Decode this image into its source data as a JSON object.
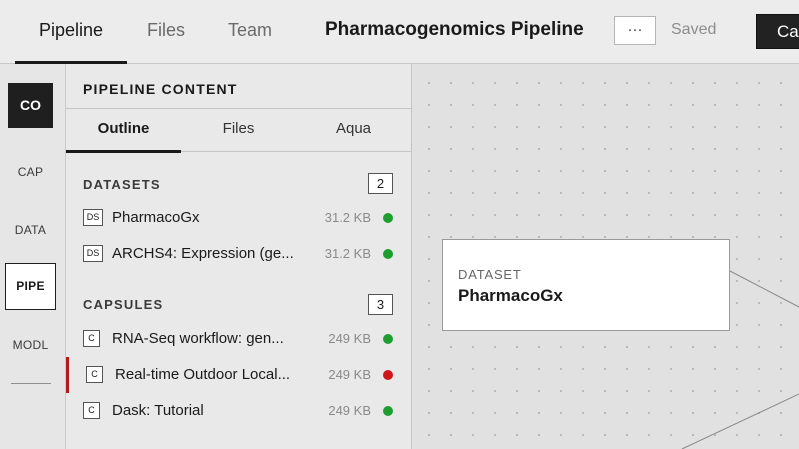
{
  "header": {
    "tabs": [
      {
        "label": "Pipeline",
        "active": true
      },
      {
        "label": "Files",
        "active": false
      },
      {
        "label": "Team",
        "active": false
      }
    ],
    "title": "Pharmacogenomics Pipeline",
    "more_label": "···",
    "status": "Saved",
    "cta_label": "Ca"
  },
  "rail": {
    "avatar": "CO",
    "items": [
      {
        "label": "CAP"
      },
      {
        "label": "DATA"
      },
      {
        "label": "PIPE",
        "active": true
      },
      {
        "label": "MODL"
      }
    ]
  },
  "panel": {
    "title": "PIPELINE CONTENT",
    "tabs": [
      {
        "label": "Outline",
        "active": true
      },
      {
        "label": "Files",
        "active": false
      },
      {
        "label": "Aqua",
        "active": false
      }
    ],
    "datasets": {
      "heading": "DATASETS",
      "count": "2",
      "items": [
        {
          "badge": "DS",
          "name": "PharmacoGx",
          "size": "31.2 KB",
          "status": "green"
        },
        {
          "badge": "DS",
          "name": "ARCHS4: Expression (ge...",
          "size": "31.2 KB",
          "status": "green"
        }
      ]
    },
    "capsules": {
      "heading": "CAPSULES",
      "count": "3",
      "items": [
        {
          "badge": "C",
          "name": "RNA-Seq workflow: gen...",
          "size": "249 KB",
          "status": "green"
        },
        {
          "badge": "C",
          "name": "Real-time Outdoor Local...",
          "size": "249 KB",
          "status": "red",
          "selected": true
        },
        {
          "badge": "C",
          "name": "Dask: Tutorial",
          "size": "249 KB",
          "status": "green"
        }
      ]
    }
  },
  "canvas": {
    "node": {
      "type": "DATASET",
      "name": "PharmacoGx"
    }
  },
  "colors": {
    "status_green": "#1e9e2f",
    "status_red": "#d0161b",
    "selected_bar": "#b31b1b",
    "dark": "#1f1f1f"
  }
}
